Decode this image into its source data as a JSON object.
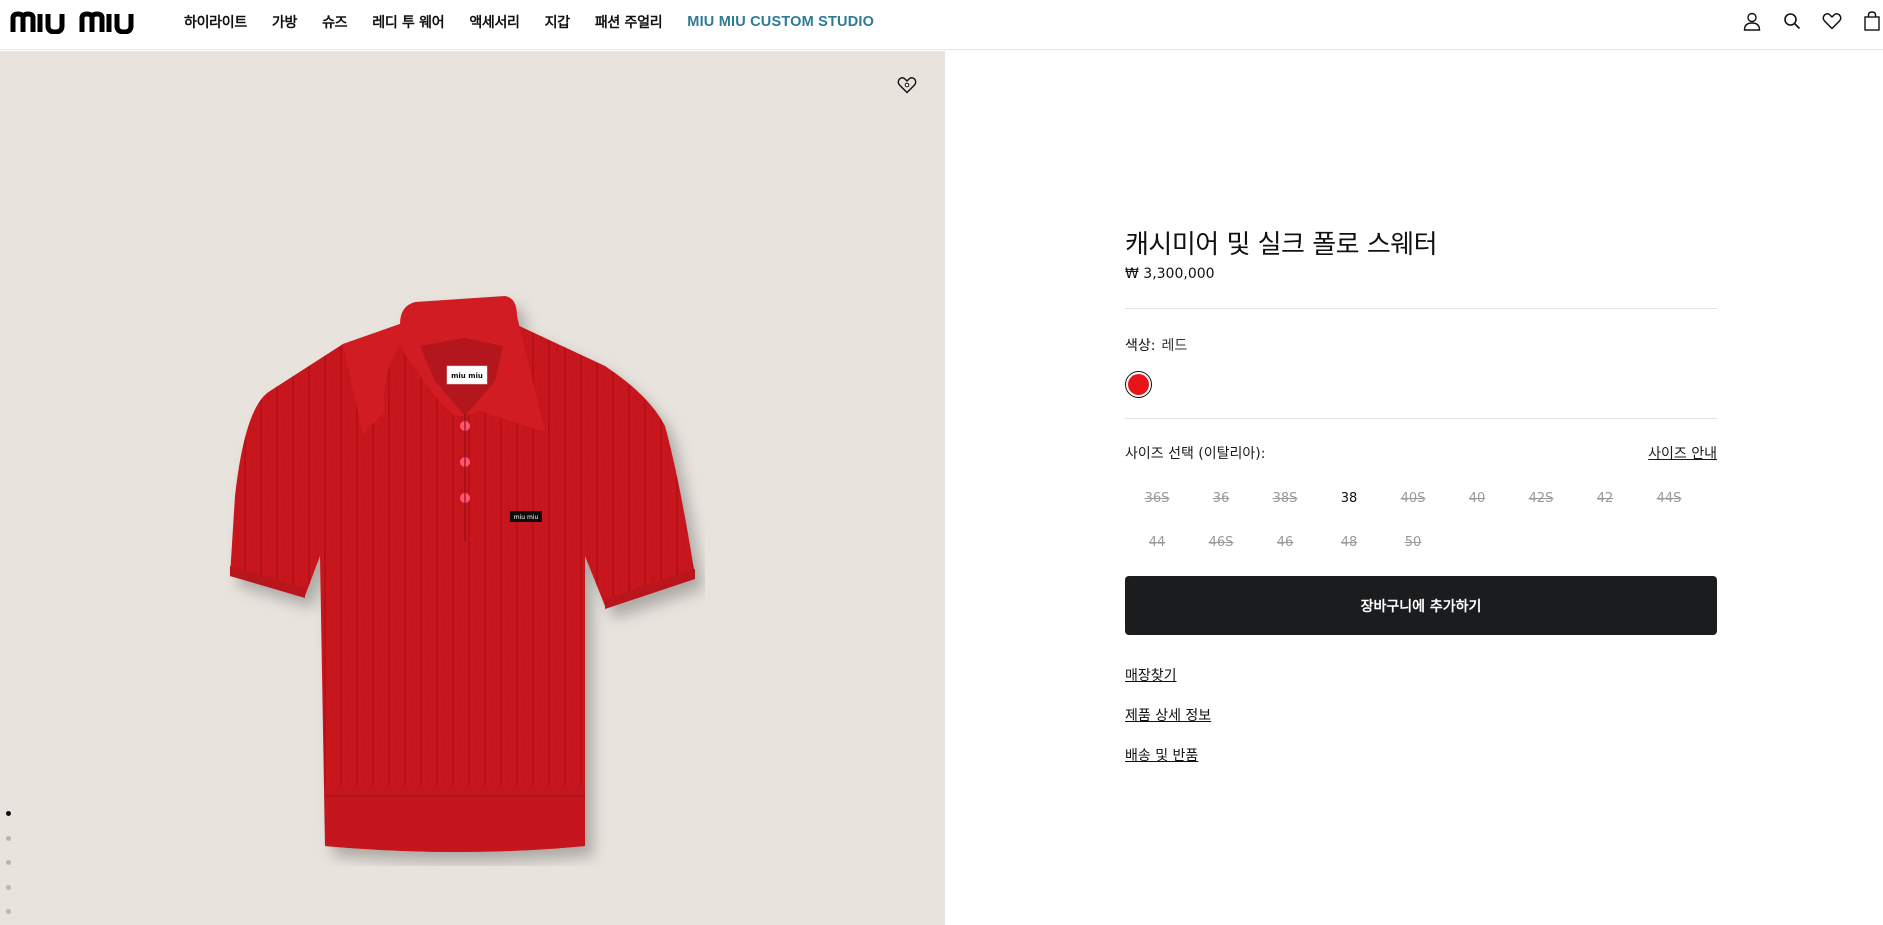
{
  "brand": {
    "logo_text": "MIU MIU"
  },
  "nav": {
    "items": [
      "하이라이트",
      "가방",
      "슈즈",
      "레디 투 웨어",
      "액세서리",
      "지갑",
      "패션 주얼리"
    ],
    "studio": "MIU MIU CUSTOM STUDIO"
  },
  "header_icons": [
    "user-icon",
    "search-icon",
    "heart-icon",
    "shopping-bag-icon"
  ],
  "gallery": {
    "slide_count": 5,
    "active_index": 0
  },
  "product": {
    "title": "캐시미어 및 실크 폴로 스웨터",
    "price": "₩ 3,300,000",
    "color_label": "색상:",
    "color_value": "레드",
    "swatch_color": "#e8141a",
    "size_label": "사이즈 선택 (이탈리아):",
    "size_guide": "사이즈 안내",
    "sizes": [
      {
        "label": "36S",
        "available": false
      },
      {
        "label": "36",
        "available": false
      },
      {
        "label": "38S",
        "available": false
      },
      {
        "label": "38",
        "available": true
      },
      {
        "label": "40S",
        "available": false
      },
      {
        "label": "40",
        "available": false
      },
      {
        "label": "42S",
        "available": false
      },
      {
        "label": "42",
        "available": false
      },
      {
        "label": "44S",
        "available": false
      },
      {
        "label": "44",
        "available": false
      },
      {
        "label": "46S",
        "available": false
      },
      {
        "label": "46",
        "available": false
      },
      {
        "label": "48",
        "available": false
      },
      {
        "label": "50",
        "available": false
      }
    ],
    "add_to_cart": "장바구니에 추가하기",
    "links": {
      "store_finder": "매장찾기",
      "details": "제품 상세 정보",
      "shipping": "배송 및 반품"
    }
  },
  "colors": {
    "accent": "#2d7a99",
    "button": "#1b1c1e",
    "image_bg": "#e8e3dd",
    "garment": "#c8181c"
  }
}
